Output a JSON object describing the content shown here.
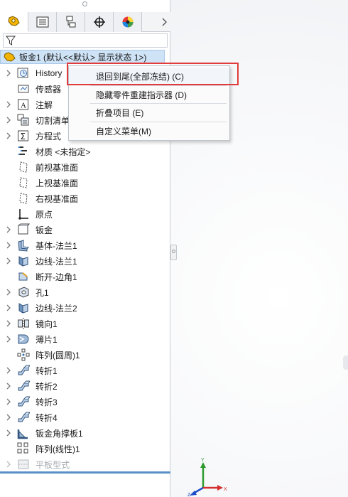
{
  "tabs": [
    {
      "icon": "feature-manager-icon",
      "active": true
    },
    {
      "icon": "property-manager-icon",
      "active": false
    },
    {
      "icon": "configuration-manager-icon",
      "active": false
    },
    {
      "icon": "dimxpert-icon",
      "active": false
    },
    {
      "icon": "display-manager-icon",
      "active": false
    }
  ],
  "tree": {
    "root_label": "钣金1 (默认<<默认> 显示状态 1>)",
    "items": [
      {
        "label": "History",
        "icon": "history-icon",
        "expandable": true
      },
      {
        "label": "传感器",
        "icon": "sensor-icon",
        "expandable": false
      },
      {
        "label": "注解",
        "icon": "annotation-icon",
        "expandable": true
      },
      {
        "label": "切割清单(",
        "icon": "cut-list-icon",
        "expandable": true
      },
      {
        "label": "方程式",
        "icon": "equation-icon",
        "expandable": true
      },
      {
        "label": "材质 <未指定>",
        "icon": "material-icon",
        "expandable": false
      },
      {
        "label": "前视基准面",
        "icon": "plane-icon",
        "expandable": false
      },
      {
        "label": "上视基准面",
        "icon": "plane-icon",
        "expandable": false
      },
      {
        "label": "右视基准面",
        "icon": "plane-icon",
        "expandable": false
      },
      {
        "label": "原点",
        "icon": "origin-icon",
        "expandable": false
      },
      {
        "label": "钣金",
        "icon": "sheet-metal-icon",
        "expandable": true
      },
      {
        "label": "基体-法兰1",
        "icon": "base-flange-icon",
        "expandable": true
      },
      {
        "label": "边线-法兰1",
        "icon": "edge-flange-icon",
        "expandable": true
      },
      {
        "label": "断开-边角1",
        "icon": "break-corner-icon",
        "expandable": false
      },
      {
        "label": "孔1",
        "icon": "hole-icon",
        "expandable": true
      },
      {
        "label": "边线-法兰2",
        "icon": "edge-flange-icon",
        "expandable": true
      },
      {
        "label": "镜向1",
        "icon": "mirror-icon",
        "expandable": true
      },
      {
        "label": "薄片1",
        "icon": "tab-feature-icon",
        "expandable": true
      },
      {
        "label": "阵列(圆周)1",
        "icon": "circular-pattern-icon",
        "expandable": false
      },
      {
        "label": "转折1",
        "icon": "jog-icon",
        "expandable": true
      },
      {
        "label": "转折2",
        "icon": "jog-icon",
        "expandable": true
      },
      {
        "label": "转折3",
        "icon": "jog-icon",
        "expandable": true
      },
      {
        "label": "转折4",
        "icon": "jog-icon",
        "expandable": true
      },
      {
        "label": "钣金角撑板1",
        "icon": "gusset-icon",
        "expandable": true
      },
      {
        "label": "阵列(线性)1",
        "icon": "linear-pattern-icon",
        "expandable": false
      },
      {
        "label": "平板型式",
        "icon": "flat-pattern-icon",
        "expandable": true,
        "disabled": true
      }
    ]
  },
  "context_menu": {
    "items": [
      {
        "label": "退回到尾(全部冻结) (C)"
      },
      {
        "label": "隐藏零件重建指示器 (D)"
      },
      {
        "label": "折叠项目 (E)"
      },
      {
        "label": "自定义菜单(M)"
      }
    ]
  },
  "triad": {
    "x_label": "X",
    "y_label": "Y",
    "z_label": "Z"
  },
  "colors": {
    "highlight_box": "#e23b3b",
    "root_selected": "#cfe3f7",
    "accent_rule": "#5b8fc7"
  }
}
